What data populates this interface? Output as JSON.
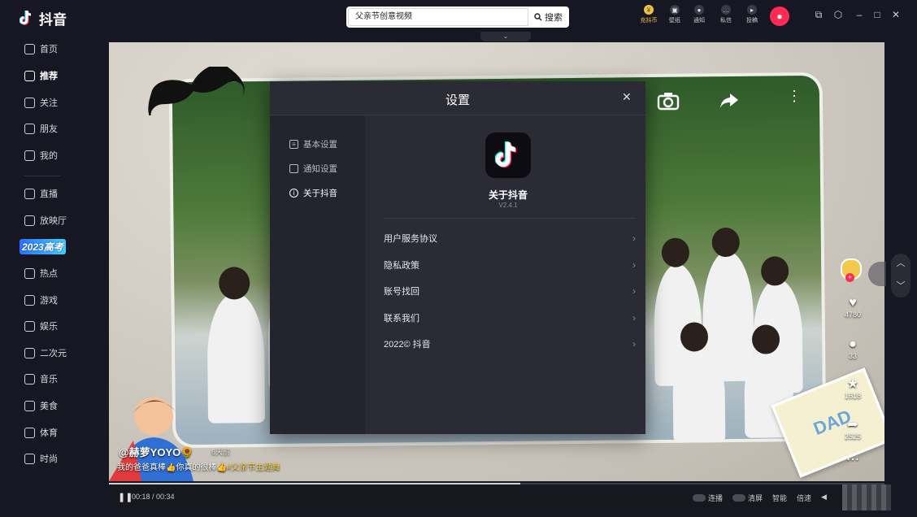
{
  "app": {
    "name": "抖音"
  },
  "sidebar": {
    "items": [
      {
        "label": "首页",
        "icon": "home-icon"
      },
      {
        "label": "推荐",
        "icon": "thumbs-up-icon",
        "active": true
      },
      {
        "label": "关注",
        "icon": "follow-icon"
      },
      {
        "label": "朋友",
        "icon": "friends-icon"
      },
      {
        "label": "我的",
        "icon": "profile-icon"
      },
      {
        "label": "直播",
        "icon": "live-tv-icon"
      },
      {
        "label": "放映厅",
        "icon": "cinema-icon"
      },
      {
        "label": "热点",
        "icon": "flame-icon"
      },
      {
        "label": "游戏",
        "icon": "gamepad-icon"
      },
      {
        "label": "娱乐",
        "icon": "smile-icon"
      },
      {
        "label": "二次元",
        "icon": "anime-icon"
      },
      {
        "label": "音乐",
        "icon": "music-icon"
      },
      {
        "label": "美食",
        "icon": "food-icon"
      },
      {
        "label": "体育",
        "icon": "ball-icon"
      },
      {
        "label": "时尚",
        "icon": "fashion-icon"
      }
    ],
    "exam_badge": "2023高考"
  },
  "search": {
    "value": "父亲节创意视频",
    "button_label": "搜索"
  },
  "topbar": {
    "icons": [
      {
        "label": "充抖币",
        "icon": "coin-icon"
      },
      {
        "label": "壁纸",
        "icon": "wallpaper-icon"
      },
      {
        "label": "通知",
        "icon": "bell-icon"
      },
      {
        "label": "私信",
        "icon": "message-icon"
      },
      {
        "label": "投稿",
        "icon": "upload-icon"
      }
    ]
  },
  "video": {
    "author": "@赫萝YOYO🌻",
    "posted": "6天前",
    "caption": "我的爸爸真棒👍你真的很棒👍",
    "hashtag": "#父亲节主题舞",
    "likes": "4780",
    "comments": "33",
    "favorites": "1618",
    "shares": "2525",
    "card_text": "DAD",
    "progress": 0.53
  },
  "player": {
    "time": "00:18 / 00:34",
    "controls": [
      "连播",
      "清屏",
      "智能",
      "倍速"
    ]
  },
  "settings_modal": {
    "title": "设置",
    "menu": [
      {
        "label": "基本设置",
        "icon": "sliders-icon"
      },
      {
        "label": "通知设置",
        "icon": "notify-icon"
      },
      {
        "label": "关于抖音",
        "icon": "info-icon",
        "active": true
      }
    ],
    "about_title": "关于抖音",
    "version": "V2.4.1",
    "links": [
      "用户服务协议",
      "隐私政策",
      "账号找回",
      "联系我们",
      "2022© 抖音"
    ]
  },
  "colors": {
    "brand_red": "#fe2c55",
    "bg_dark": "#161722",
    "modal_bg": "#2a2b35"
  }
}
